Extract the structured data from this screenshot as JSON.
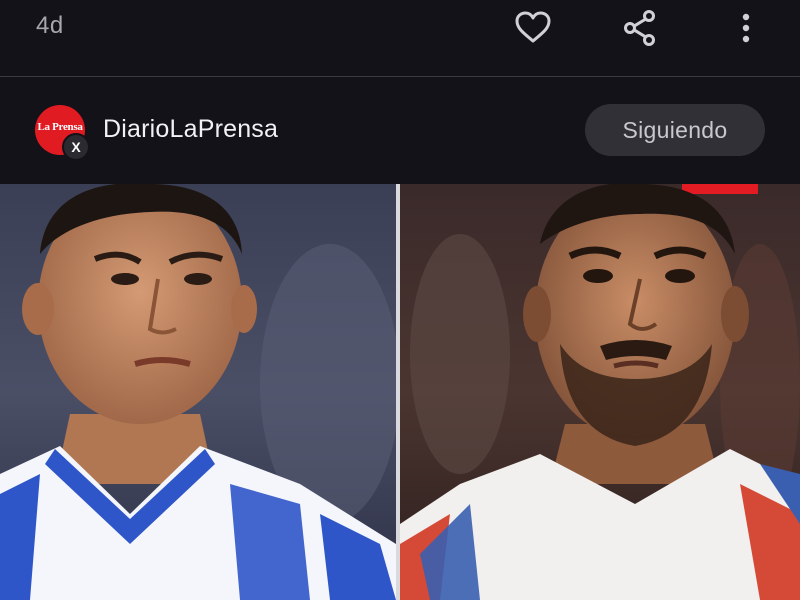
{
  "post": {
    "timestamp": "4d"
  },
  "actions": {
    "like_icon": "heart-icon",
    "share_icon": "share-icon",
    "more_icon": "more-vertical-icon"
  },
  "author": {
    "name": "DiarioLaPrensa",
    "avatar_text": "La Prensa",
    "source_badge": "X",
    "follow_label": "Siguiendo"
  },
  "colors": {
    "background": "#121218",
    "avatar_red": "#e01b22",
    "follow_button_bg": "#303036",
    "icon_color": "#d0d0d6"
  }
}
